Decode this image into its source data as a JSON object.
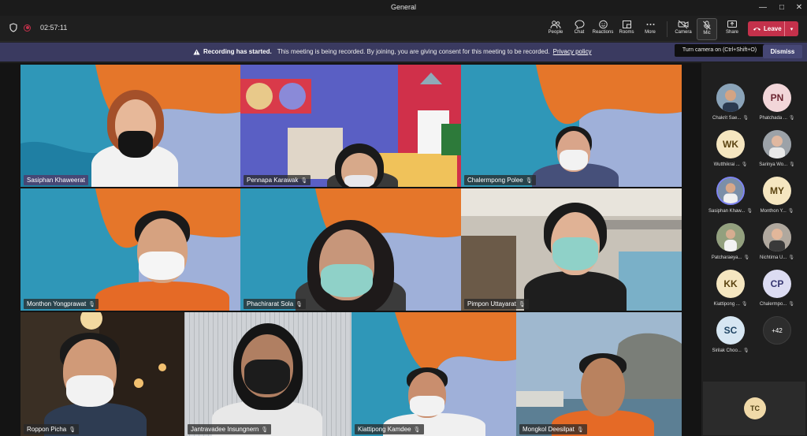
{
  "window": {
    "title": "General",
    "controls": [
      "—",
      "□",
      "✕"
    ]
  },
  "toolbar": {
    "timer": "02:57:11",
    "buttons": [
      {
        "label": "People",
        "icon": "people-icon"
      },
      {
        "label": "Chat",
        "icon": "chat-icon"
      },
      {
        "label": "Reactions",
        "icon": "reactions-icon"
      },
      {
        "label": "Rooms",
        "icon": "rooms-icon"
      },
      {
        "label": "More",
        "icon": "more-icon"
      },
      {
        "label": "Camera",
        "icon": "camera-off-icon"
      },
      {
        "label": "Mic",
        "icon": "mic-icon"
      },
      {
        "label": "Share",
        "icon": "share-icon"
      }
    ],
    "leave_label": "Leave"
  },
  "banner": {
    "bold": "Recording has started.",
    "text": "This meeting is being recorded. By joining, you are giving consent for this meeting to be recorded.",
    "link": "Privacy policy",
    "dismiss": "Dismiss",
    "tooltip": "Turn camera on (Ctrl+Shift+O)"
  },
  "tiles": [
    {
      "name": "Sasiphan  Khaweerat",
      "mic": false,
      "active": true
    },
    {
      "name": "Pennapa Karawak",
      "mic": true,
      "active": false
    },
    {
      "name": "Chalermpong  Polee",
      "mic": true,
      "active": false
    },
    {
      "name": "Monthon Yongprawat",
      "mic": true,
      "active": false
    },
    {
      "name": "Phachirarat  Sola",
      "mic": true,
      "active": false
    },
    {
      "name": "Pimpon  Uttayarat",
      "mic": true,
      "active": false
    },
    {
      "name": "Roppon  Picha",
      "mic": true,
      "active": false
    },
    {
      "name": "Jantravadee  Insungnern",
      "mic": true,
      "active": false
    },
    {
      "name": "Kiattipong  Kamdee",
      "mic": true,
      "active": false
    },
    {
      "name": "Mongkol  Deesilpat",
      "mic": true,
      "active": false
    }
  ],
  "roster": [
    {
      "initials": "",
      "name": "Chakrit Sae...",
      "photo": true,
      "bg": "#5a6e80"
    },
    {
      "initials": "PN",
      "name": "Phatchada ...",
      "photo": false,
      "bg": "#f2d6d9",
      "fg": "#6b2430"
    },
    {
      "initials": "WK",
      "name": "Wutthikrai ...",
      "photo": false,
      "bg": "#f5e6c0",
      "fg": "#5a4310"
    },
    {
      "initials": "",
      "name": "Sarinya Wo...",
      "photo": true,
      "bg": "#8c8f96"
    },
    {
      "initials": "",
      "name": "Sasiphan Khaw...",
      "photo": true,
      "bg": "#6d7f98"
    },
    {
      "initials": "MY",
      "name": "Monthon Y...",
      "photo": false,
      "bg": "#f5e6c0",
      "fg": "#5a4310"
    },
    {
      "initials": "",
      "name": "Patcharaeya...",
      "photo": true,
      "bg": "#7e8a6b"
    },
    {
      "initials": "",
      "name": "Nichtima U...",
      "photo": true,
      "bg": "#9a8f86"
    },
    {
      "initials": "KK",
      "name": "Kiattipong ...",
      "photo": false,
      "bg": "#f5e6c0",
      "fg": "#5a4310"
    },
    {
      "initials": "CP",
      "name": "Chalermpo...",
      "photo": false,
      "bg": "#dcdcf2",
      "fg": "#353570"
    },
    {
      "initials": "SC",
      "name": "Sirilak Choo...",
      "photo": false,
      "bg": "#d6e6f2",
      "fg": "#1f4463"
    },
    {
      "initials": "+42",
      "name": "",
      "photo": false,
      "bg": "#2d2d2d",
      "fg": "#ffffff"
    }
  ],
  "self": {
    "initials": "TC"
  }
}
